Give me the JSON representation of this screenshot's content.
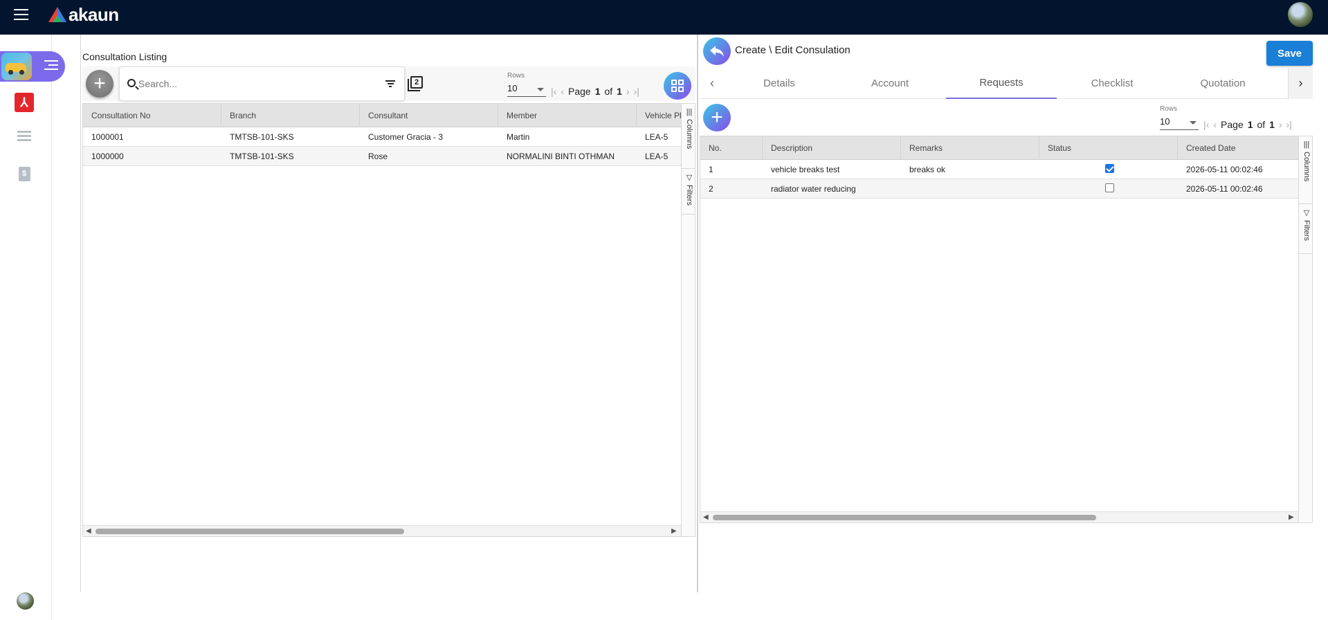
{
  "header": {
    "logo_text": "akaun",
    "menu_icon": "hamburger-icon",
    "user_icon": "user-avatar"
  },
  "sidebar": {
    "items": [
      {
        "icon": "car-service-app-icon"
      },
      {
        "icon": "pdf-icon"
      },
      {
        "icon": "list-icon"
      },
      {
        "icon": "document-icon"
      }
    ]
  },
  "listing": {
    "title": "Consultation Listing",
    "search_placeholder": "Search...",
    "rows_label": "Rows",
    "rows_value": "10",
    "page_label": "Page",
    "page_current": "1",
    "page_of": "of",
    "page_total": "1",
    "columns": [
      "Consultation No",
      "Branch",
      "Consultant",
      "Member",
      "Vehicle Pl"
    ],
    "rows": [
      [
        "1000001",
        "TMTSB-101-SKS",
        "Customer Gracia - 3",
        "Martin",
        "LEA-5"
      ],
      [
        "1000000",
        "TMTSB-101-SKS",
        "Rose",
        "NORMALINI BINTI OTHMAN",
        "LEA-5"
      ]
    ],
    "side_tabs": {
      "columns": "Columns",
      "filters": "Filters"
    }
  },
  "form": {
    "title": "Create \\ Edit Consulation",
    "save_label": "Save",
    "tabs": [
      "Details",
      "Account",
      "Requests",
      "Checklist",
      "Quotation"
    ],
    "active_tab": "Requests",
    "rows_label": "Rows",
    "rows_value": "10",
    "page_label": "Page",
    "page_current": "1",
    "page_of": "of",
    "page_total": "1",
    "columns": [
      "No.",
      "Description",
      "Remarks",
      "Status",
      "Created Date"
    ],
    "rows": [
      {
        "no": "1",
        "description": "vehicle breaks test",
        "remarks": "breaks ok",
        "status_checked": true,
        "created": "2026-05-11 00:02:46"
      },
      {
        "no": "2",
        "description": "radiator water reducing",
        "remarks": "",
        "status_checked": false,
        "created": "2026-05-11 00:02:46"
      }
    ],
    "side_tabs": {
      "columns": "Columns",
      "filters": "Filters"
    }
  },
  "colors": {
    "topbar": "#03152e",
    "accent_gradient_start": "#38c7e6",
    "accent_gradient_end": "#8a4be8",
    "save": "#1a7fd6",
    "pill": "#7b6bea"
  }
}
